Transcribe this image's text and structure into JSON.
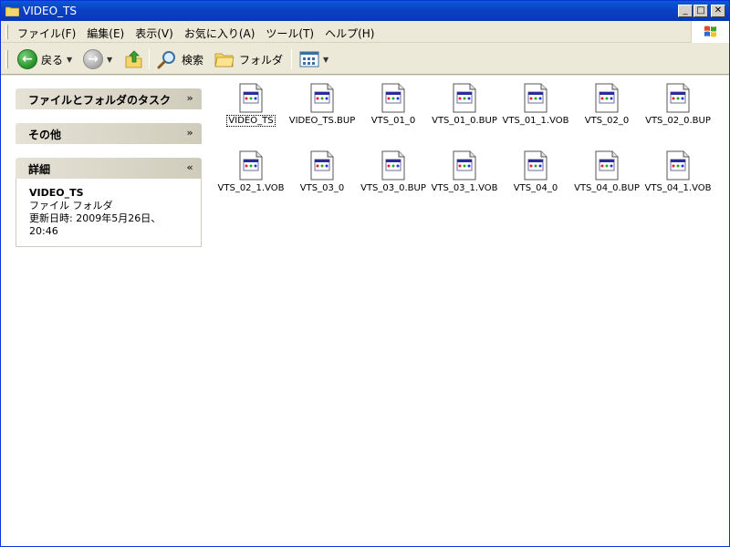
{
  "window": {
    "title": "VIDEO_TS",
    "buttons": {
      "minimize": "_",
      "maximize": "□",
      "close": "✕"
    }
  },
  "menubar": {
    "items": [
      "ファイル(F)",
      "編集(E)",
      "表示(V)",
      "お気に入り(A)",
      "ツール(T)",
      "ヘルプ(H)"
    ]
  },
  "toolbar": {
    "back_label": "戻る",
    "search_label": "検索",
    "folder_label": "フォルダ"
  },
  "sidepanel": {
    "groups": [
      {
        "title": "ファイルとフォルダのタスク",
        "collapsed": true
      },
      {
        "title": "その他",
        "collapsed": true
      },
      {
        "title": "詳細",
        "collapsed": false,
        "details": {
          "name": "VIDEO_TS",
          "type": "ファイル フォルダ",
          "modified_line1": "更新日時: 2009年5月26日、",
          "modified_line2": "20:46"
        }
      }
    ]
  },
  "files": [
    {
      "name": "VIDEO_TS",
      "selected": true
    },
    {
      "name": "VIDEO_TS.BUP"
    },
    {
      "name": "VTS_01_0"
    },
    {
      "name": "VTS_01_0.BUP"
    },
    {
      "name": "VTS_01_1.VOB"
    },
    {
      "name": "VTS_02_0"
    },
    {
      "name": "VTS_02_0.BUP"
    },
    {
      "name": "VTS_02_1.VOB"
    },
    {
      "name": "VTS_03_0"
    },
    {
      "name": "VTS_03_0.BUP"
    },
    {
      "name": "VTS_03_1.VOB"
    },
    {
      "name": "VTS_04_0"
    },
    {
      "name": "VTS_04_0.BUP"
    },
    {
      "name": "VTS_04_1.VOB"
    }
  ]
}
